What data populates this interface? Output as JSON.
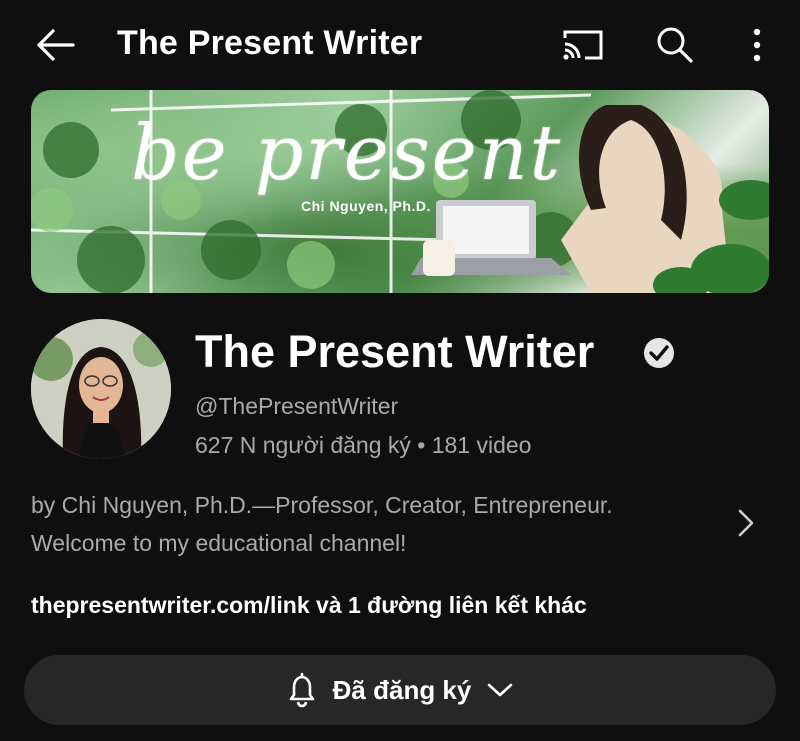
{
  "header": {
    "title": "The Present Writer",
    "icons": [
      "back-arrow-icon",
      "cast-icon",
      "search-icon",
      "more-vert-icon"
    ]
  },
  "banner": {
    "script_text": "be present",
    "subtitle": "Chi Nguyen, Ph.D."
  },
  "channel": {
    "name": "The Present Writer",
    "verified": true,
    "handle": "@ThePresentWriter",
    "stats": "627 N người đăng ký • 181 video",
    "description_line1": "by Chi Nguyen, Ph.D.—Professor, Creator, Entrepreneur.",
    "description_line2": "Welcome to my educational channel!",
    "link_text": "thepresentwriter.com/link và 1 đường liên kết khác"
  },
  "subscribe_button": {
    "label": "Đã đăng ký",
    "icons": [
      "bell-icon",
      "chevron-down-icon"
    ]
  },
  "colors": {
    "background": "#0f0f0f",
    "secondary_text": "#aaaaaa",
    "button_bg": "#272727"
  }
}
